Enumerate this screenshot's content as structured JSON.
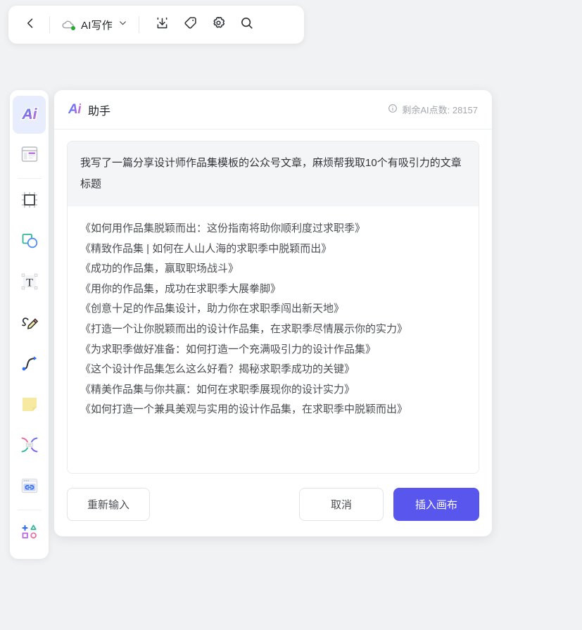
{
  "toolbar": {
    "back_icon": "chevron-left-icon",
    "cloud_icon": "cloud-sync-icon",
    "doc_title": "AI写作",
    "dropdown_icon": "chevron-down-icon",
    "import_icon": "download-icon",
    "tag_icon": "tag-icon",
    "settings_icon": "gear-icon",
    "search_icon": "search-icon"
  },
  "sidebar": {
    "items": [
      {
        "name": "ai-assistant",
        "icon": "ai-icon",
        "active": true
      },
      {
        "name": "template",
        "icon": "template-icon",
        "active": false
      },
      {
        "name": "frame",
        "icon": "frame-icon",
        "active": false
      },
      {
        "name": "shape",
        "icon": "shape-icon",
        "active": false
      },
      {
        "name": "text",
        "icon": "text-icon",
        "active": false
      },
      {
        "name": "pencil",
        "icon": "pencil-icon",
        "active": false
      },
      {
        "name": "pen-curve",
        "icon": "pen-curve-icon",
        "active": false
      },
      {
        "name": "sticky-note",
        "icon": "sticky-note-icon",
        "active": false
      },
      {
        "name": "connector",
        "icon": "connector-icon",
        "active": false
      },
      {
        "name": "embed-link",
        "icon": "link-embed-icon",
        "active": false
      },
      {
        "name": "more-shapes",
        "icon": "more-shapes-icon",
        "active": false
      }
    ]
  },
  "panel": {
    "logo_text": "Ai",
    "title": "助手",
    "info_icon": "info-circle-icon",
    "points_label": "剩余AI点数: 28157",
    "prompt": "我写了一篇分享设计师作品集模板的公众号文章，麻烦帮我取10个有吸引力的文章标题",
    "answers": [
      "《如何用作品集脱颖而出：这份指南将助你顺利度过求职季》",
      "《精致作品集 | 如何在人山人海的求职季中脱颖而出》",
      "《成功的作品集，赢取职场战斗》",
      "《用你的作品集，成功在求职季大展拳脚》",
      "《创意十足的作品集设计，助力你在求职季闯出新天地》",
      "《打造一个让你脱颖而出的设计作品集，在求职季尽情展示你的实力》",
      "《为求职季做好准备：如何打造一个充满吸引力的设计作品集》",
      "《这个设计作品集怎么这么好看？揭秘求职季成功的关键》",
      "《精美作品集与你共赢：如何在求职季展现你的设计实力》",
      "《如何打造一个兼具美观与实用的设计作品集，在求职季中脱颖而出》"
    ],
    "buttons": {
      "retry": "重新输入",
      "cancel": "取消",
      "insert": "插入画布"
    }
  },
  "colors": {
    "primary": "#5856ec",
    "page_bg": "#f1f2f4",
    "panel_bg": "#ffffff",
    "prompt_bg": "#f4f5f7",
    "active_tool_bg": "#e7edfd",
    "sync_dot": "#2aa832"
  }
}
